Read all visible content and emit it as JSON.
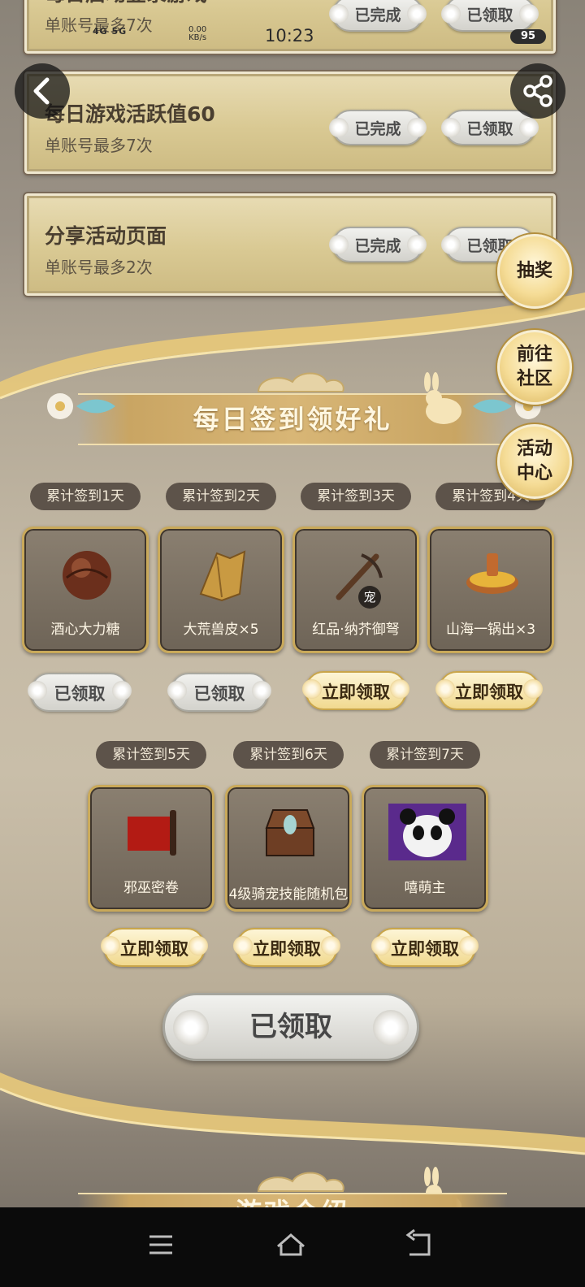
{
  "status_bar": {
    "network": "4G 5G",
    "speed_value": "0.00",
    "speed_unit": "KB/s",
    "time": "10:23",
    "battery": "95"
  },
  "tasks": [
    {
      "title": "每日启动登录游戏",
      "subtitle": "单账号最多7次",
      "status_done": "已完成",
      "status_claim": "已领取"
    },
    {
      "title": "每日游戏活跃值60",
      "subtitle": "单账号最多7次",
      "status_done": "已完成",
      "status_claim": "已领取"
    },
    {
      "title": "分享活动页面",
      "subtitle": "单账号最多2次",
      "status_done": "已完成",
      "status_claim": "已领取"
    }
  ],
  "side_buttons": {
    "lottery": "抽奖",
    "community": "前往\n社区",
    "activity_center": "活动\n中心"
  },
  "signin": {
    "banner_title": "每日签到领好礼",
    "days": [
      {
        "label": "累计签到1天",
        "reward": "酒心大力糖",
        "button": "已领取",
        "claimed": true
      },
      {
        "label": "累计签到2天",
        "reward": "大荒兽皮×5",
        "button": "已领取",
        "claimed": true
      },
      {
        "label": "累计签到3天",
        "reward": "红品·纳芥御弩",
        "badge": "宠",
        "button": "立即领取",
        "claimed": false
      },
      {
        "label": "累计签到4天",
        "reward": "山海一锅出×3",
        "button": "立即领取",
        "claimed": false
      },
      {
        "label": "累计签到5天",
        "reward": "邪巫密卷",
        "button": "立即领取",
        "claimed": false
      },
      {
        "label": "累计签到6天",
        "reward": "4级骑宠技能随机包",
        "button": "立即领取",
        "claimed": false
      },
      {
        "label": "累计签到7天",
        "reward": "嘻萌主",
        "button": "立即领取",
        "claimed": false
      }
    ],
    "main_button": "已领取"
  },
  "next_banner_partial": "游戏介绍",
  "colors": {
    "gold": "#d9b676",
    "card_bg": "#e3d6a8",
    "label_bg": "#5d534a"
  },
  "icons": [
    "back-arrow-icon",
    "share-icon",
    "menu-icon",
    "home-icon",
    "back-icon"
  ]
}
